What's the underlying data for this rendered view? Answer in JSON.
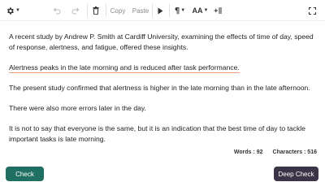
{
  "toolbar": {
    "copy_label": "Copy",
    "paste_label": "Paste",
    "font_size_label": "AA",
    "icons": [
      "gear-icon",
      "undo-icon",
      "redo-icon",
      "trash-icon",
      "play-icon",
      "paragraph-icon",
      "font-size-icon",
      "insert-icon",
      "fullscreen-icon"
    ]
  },
  "editor": {
    "paragraphs": [
      "A recent study by Andrew P. Smith at Cardiff University, examining the effects of time of day, speed of response, alertness, and fatigue, offered these insights.",
      "Alertness peaks in the late morning and is reduced after task performance.",
      "The present study confirmed that alertness is higher in the late morning than in the late afternoon.",
      "There were also more errors later in the day.",
      "It is not to say that everyone is the same, but it is an indication that the best time of day to tackle important tasks is late morning."
    ]
  },
  "status": {
    "words_label": "Words : 92",
    "characters_label": "Characters : 516"
  },
  "actions": {
    "check_label": "Check",
    "deep_check_label": "Deep Check"
  },
  "colors": {
    "check_button": "#1f6f62",
    "deep_check_button": "#3b3346",
    "flag_underline": "#e9a07a"
  }
}
